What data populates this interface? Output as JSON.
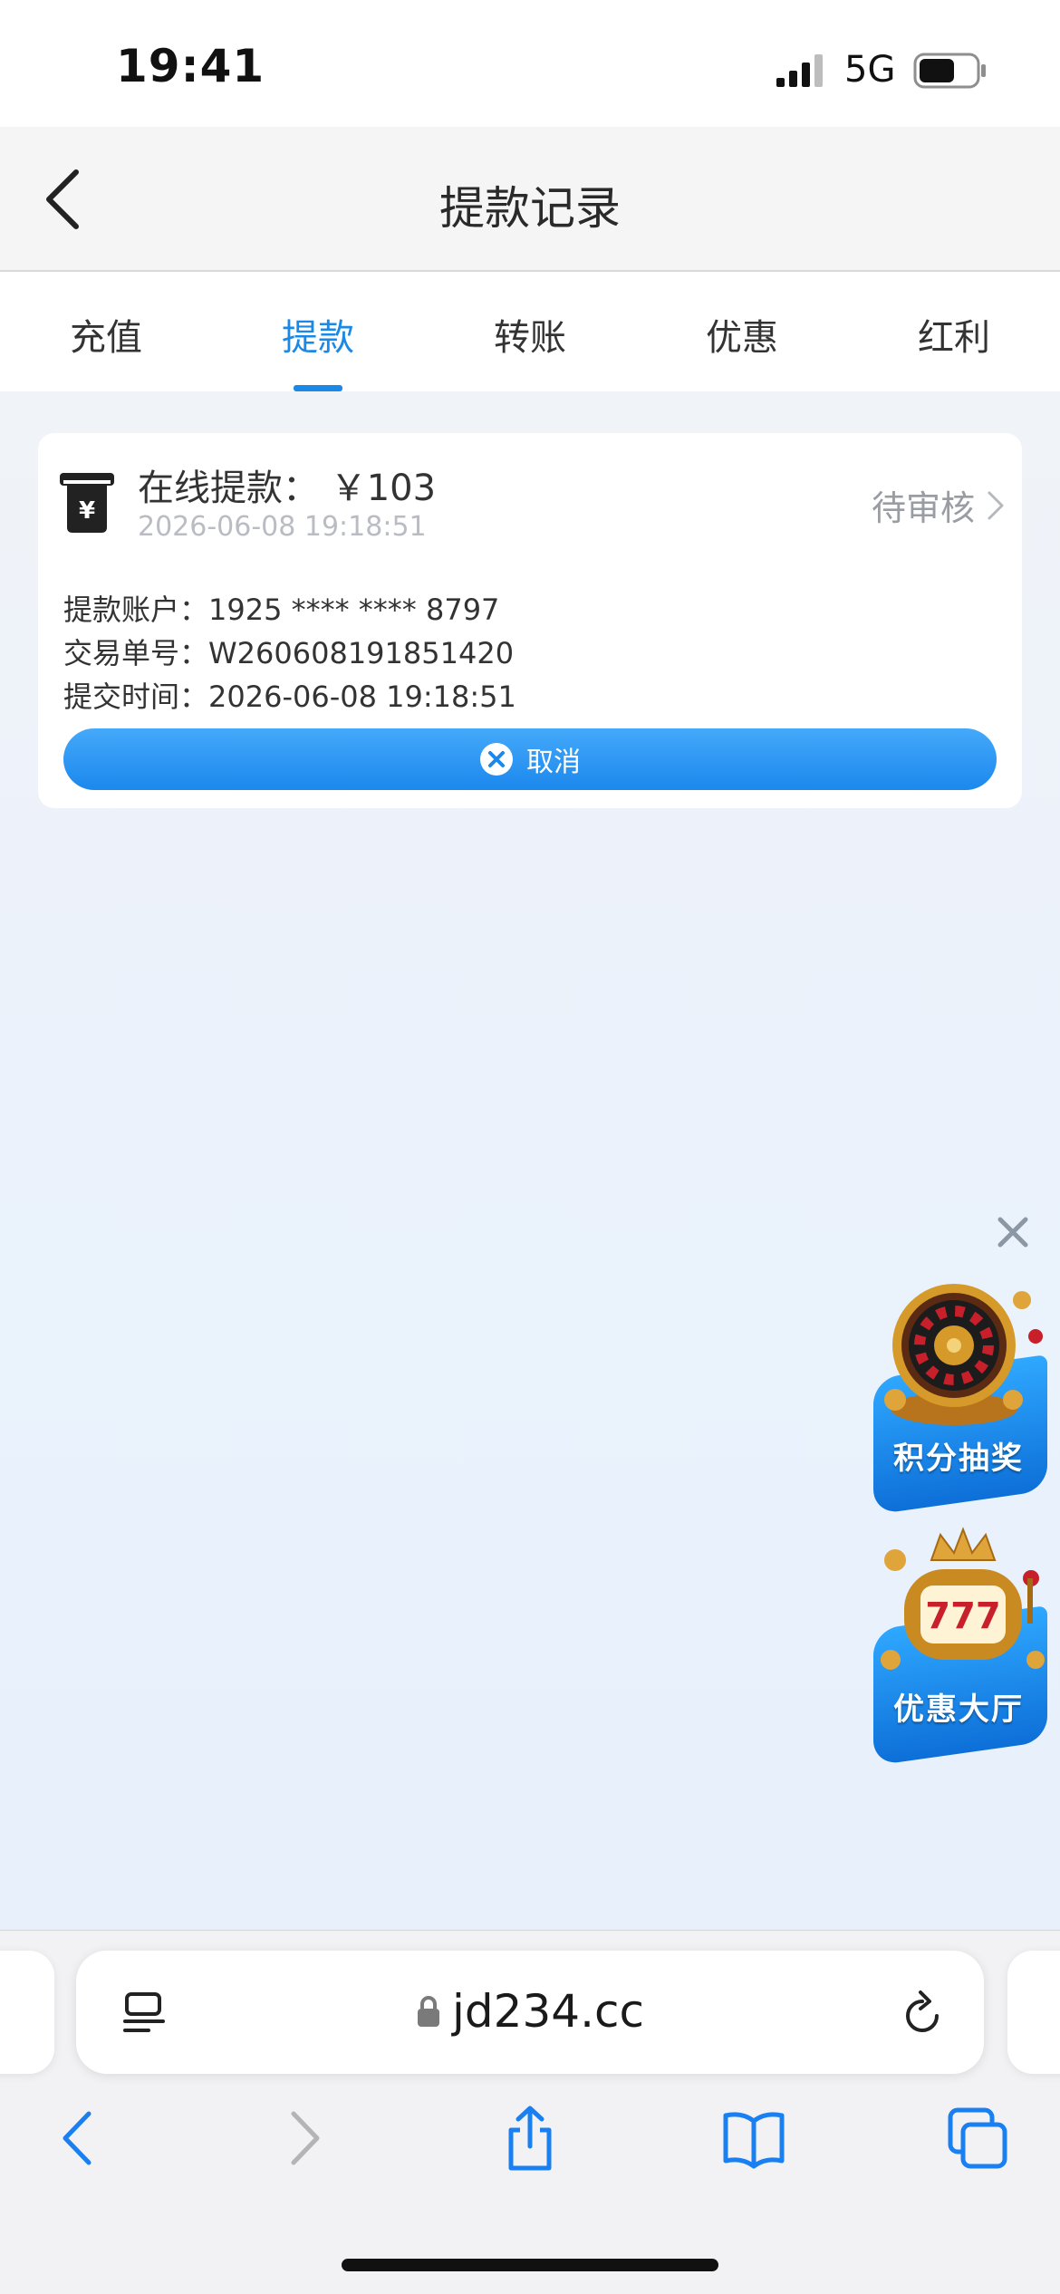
{
  "status_bar": {
    "time": "19:41",
    "network": "5G",
    "icons": [
      "signal-icon",
      "battery-icon"
    ]
  },
  "header": {
    "title": "提款记录",
    "back_icon": "chevron-left-icon"
  },
  "tabs": [
    {
      "label": "充值",
      "active": false
    },
    {
      "label": "提款",
      "active": true
    },
    {
      "label": "转账",
      "active": false
    },
    {
      "label": "优惠",
      "active": false
    },
    {
      "label": "红利",
      "active": false
    }
  ],
  "record": {
    "icon": "atm-yen-icon",
    "title": "在线提款： ￥103",
    "date": "2026-06-08 19:18:51",
    "status": "待审核",
    "details": [
      {
        "key": "提款账户：",
        "value": "1925 **** **** 8797"
      },
      {
        "key": "交易单号：",
        "value": "W260608191851420"
      },
      {
        "key": "提交时间：",
        "value": "2026-06-08 19:18:51"
      }
    ],
    "cancel_label": "取消"
  },
  "floating": {
    "close_icon": "close-icon",
    "promos": [
      {
        "label": "积分抽奖",
        "icon": "roulette-icon"
      },
      {
        "label": "优惠大厅",
        "icon": "slot-machine-icon"
      }
    ]
  },
  "browser": {
    "url": "jd234.cc",
    "toolbar_icons": [
      "back-arrow-icon",
      "forward-arrow-icon",
      "share-icon",
      "bookmarks-icon",
      "tabs-icon"
    ]
  },
  "colors": {
    "accent": "#1a88e6",
    "button_top": "#45a9fb",
    "button_bottom": "#1b88ec",
    "status_gray": "#999da3"
  }
}
